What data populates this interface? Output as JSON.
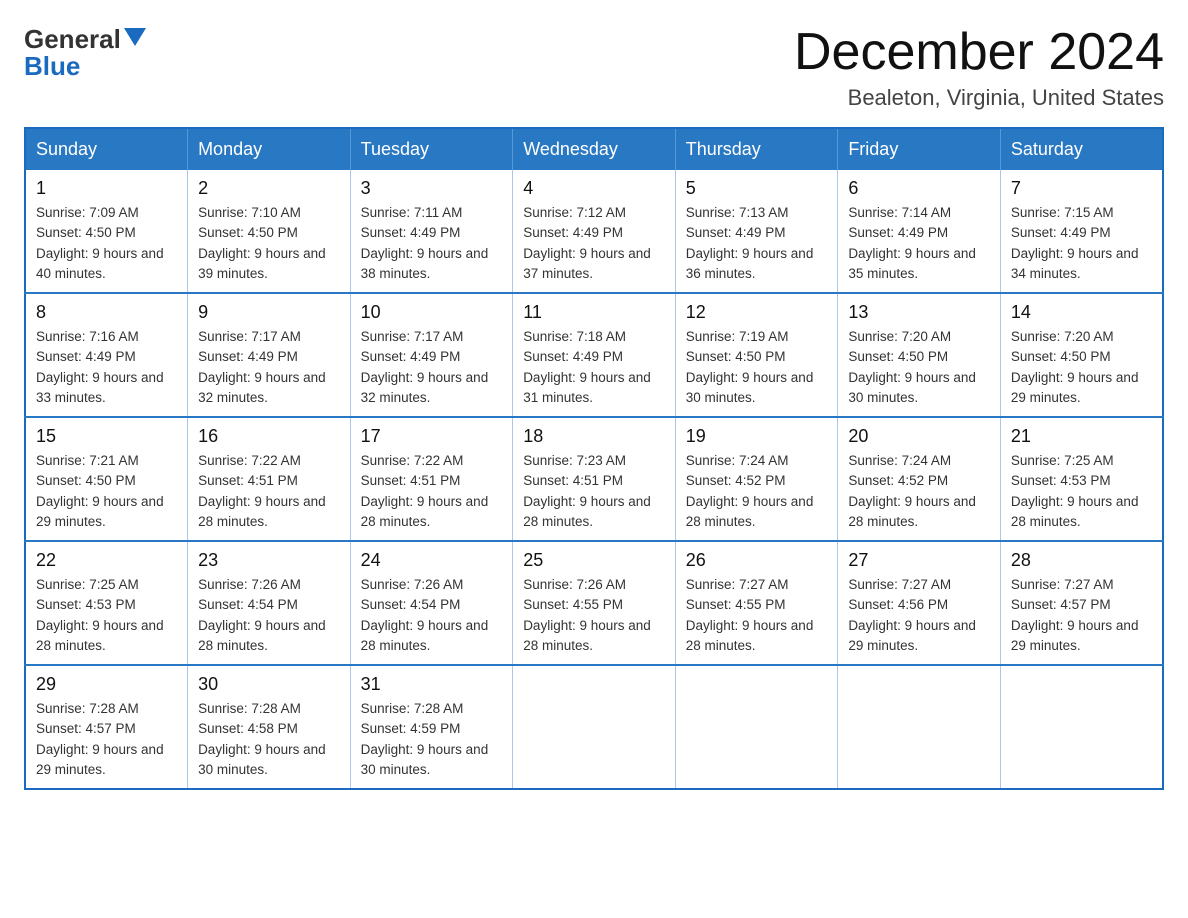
{
  "header": {
    "logo_general": "General",
    "logo_blue": "Blue",
    "month_title": "December 2024",
    "location": "Bealeton, Virginia, United States"
  },
  "days_of_week": [
    "Sunday",
    "Monday",
    "Tuesday",
    "Wednesday",
    "Thursday",
    "Friday",
    "Saturday"
  ],
  "weeks": [
    [
      {
        "day": "1",
        "sunrise": "7:09 AM",
        "sunset": "4:50 PM",
        "daylight": "9 hours and 40 minutes."
      },
      {
        "day": "2",
        "sunrise": "7:10 AM",
        "sunset": "4:50 PM",
        "daylight": "9 hours and 39 minutes."
      },
      {
        "day": "3",
        "sunrise": "7:11 AM",
        "sunset": "4:49 PM",
        "daylight": "9 hours and 38 minutes."
      },
      {
        "day": "4",
        "sunrise": "7:12 AM",
        "sunset": "4:49 PM",
        "daylight": "9 hours and 37 minutes."
      },
      {
        "day": "5",
        "sunrise": "7:13 AM",
        "sunset": "4:49 PM",
        "daylight": "9 hours and 36 minutes."
      },
      {
        "day": "6",
        "sunrise": "7:14 AM",
        "sunset": "4:49 PM",
        "daylight": "9 hours and 35 minutes."
      },
      {
        "day": "7",
        "sunrise": "7:15 AM",
        "sunset": "4:49 PM",
        "daylight": "9 hours and 34 minutes."
      }
    ],
    [
      {
        "day": "8",
        "sunrise": "7:16 AM",
        "sunset": "4:49 PM",
        "daylight": "9 hours and 33 minutes."
      },
      {
        "day": "9",
        "sunrise": "7:17 AM",
        "sunset": "4:49 PM",
        "daylight": "9 hours and 32 minutes."
      },
      {
        "day": "10",
        "sunrise": "7:17 AM",
        "sunset": "4:49 PM",
        "daylight": "9 hours and 32 minutes."
      },
      {
        "day": "11",
        "sunrise": "7:18 AM",
        "sunset": "4:49 PM",
        "daylight": "9 hours and 31 minutes."
      },
      {
        "day": "12",
        "sunrise": "7:19 AM",
        "sunset": "4:50 PM",
        "daylight": "9 hours and 30 minutes."
      },
      {
        "day": "13",
        "sunrise": "7:20 AM",
        "sunset": "4:50 PM",
        "daylight": "9 hours and 30 minutes."
      },
      {
        "day": "14",
        "sunrise": "7:20 AM",
        "sunset": "4:50 PM",
        "daylight": "9 hours and 29 minutes."
      }
    ],
    [
      {
        "day": "15",
        "sunrise": "7:21 AM",
        "sunset": "4:50 PM",
        "daylight": "9 hours and 29 minutes."
      },
      {
        "day": "16",
        "sunrise": "7:22 AM",
        "sunset": "4:51 PM",
        "daylight": "9 hours and 28 minutes."
      },
      {
        "day": "17",
        "sunrise": "7:22 AM",
        "sunset": "4:51 PM",
        "daylight": "9 hours and 28 minutes."
      },
      {
        "day": "18",
        "sunrise": "7:23 AM",
        "sunset": "4:51 PM",
        "daylight": "9 hours and 28 minutes."
      },
      {
        "day": "19",
        "sunrise": "7:24 AM",
        "sunset": "4:52 PM",
        "daylight": "9 hours and 28 minutes."
      },
      {
        "day": "20",
        "sunrise": "7:24 AM",
        "sunset": "4:52 PM",
        "daylight": "9 hours and 28 minutes."
      },
      {
        "day": "21",
        "sunrise": "7:25 AM",
        "sunset": "4:53 PM",
        "daylight": "9 hours and 28 minutes."
      }
    ],
    [
      {
        "day": "22",
        "sunrise": "7:25 AM",
        "sunset": "4:53 PM",
        "daylight": "9 hours and 28 minutes."
      },
      {
        "day": "23",
        "sunrise": "7:26 AM",
        "sunset": "4:54 PM",
        "daylight": "9 hours and 28 minutes."
      },
      {
        "day": "24",
        "sunrise": "7:26 AM",
        "sunset": "4:54 PM",
        "daylight": "9 hours and 28 minutes."
      },
      {
        "day": "25",
        "sunrise": "7:26 AM",
        "sunset": "4:55 PM",
        "daylight": "9 hours and 28 minutes."
      },
      {
        "day": "26",
        "sunrise": "7:27 AM",
        "sunset": "4:55 PM",
        "daylight": "9 hours and 28 minutes."
      },
      {
        "day": "27",
        "sunrise": "7:27 AM",
        "sunset": "4:56 PM",
        "daylight": "9 hours and 29 minutes."
      },
      {
        "day": "28",
        "sunrise": "7:27 AM",
        "sunset": "4:57 PM",
        "daylight": "9 hours and 29 minutes."
      }
    ],
    [
      {
        "day": "29",
        "sunrise": "7:28 AM",
        "sunset": "4:57 PM",
        "daylight": "9 hours and 29 minutes."
      },
      {
        "day": "30",
        "sunrise": "7:28 AM",
        "sunset": "4:58 PM",
        "daylight": "9 hours and 30 minutes."
      },
      {
        "day": "31",
        "sunrise": "7:28 AM",
        "sunset": "4:59 PM",
        "daylight": "9 hours and 30 minutes."
      },
      null,
      null,
      null,
      null
    ]
  ],
  "labels": {
    "sunrise": "Sunrise:",
    "sunset": "Sunset:",
    "daylight": "Daylight:"
  }
}
